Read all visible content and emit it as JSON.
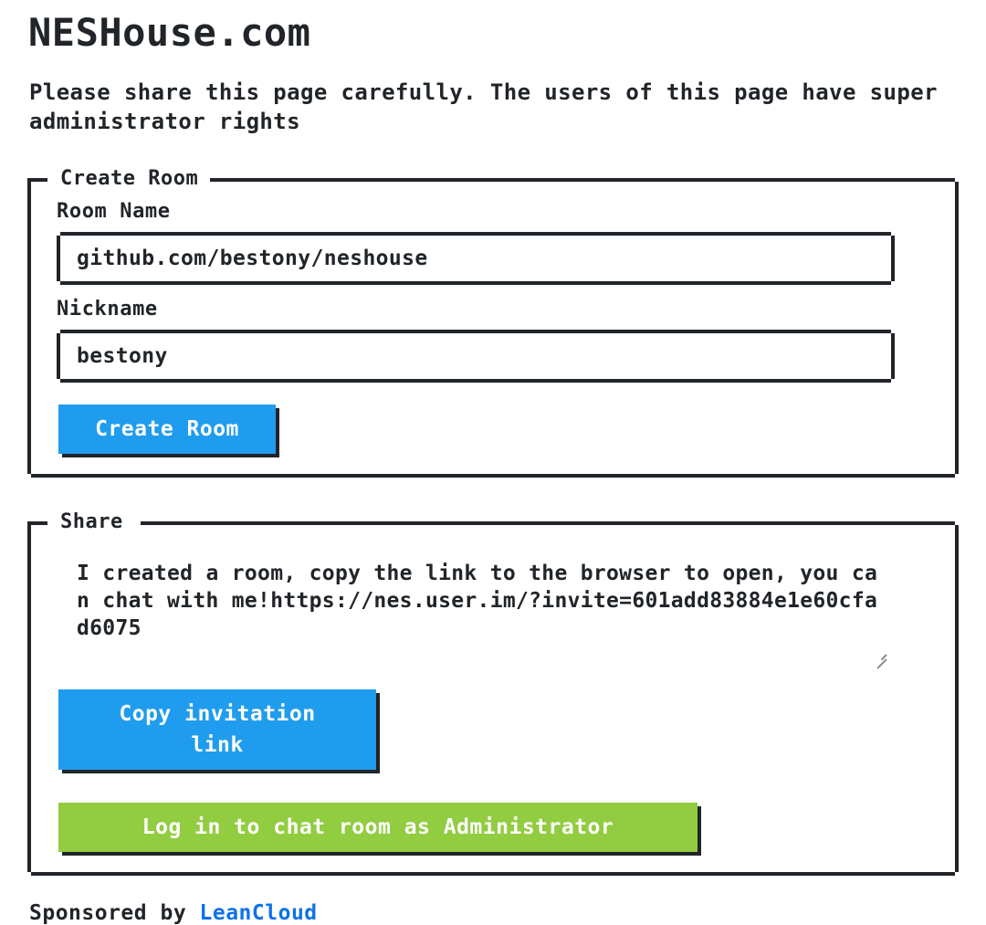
{
  "header": {
    "site_title": "NESHouse.com",
    "notice": "Please share this page carefully. The users of this page have super administrator rights"
  },
  "create_room": {
    "legend": "Create Room",
    "room_name_label": "Room Name",
    "room_name_value": "github.com/bestony/neshouse",
    "room_name_placeholder": "Room Name",
    "nickname_label": "Nickname",
    "nickname_value": "bestony",
    "nickname_placeholder": "Nickname",
    "create_button_label": "Create Room"
  },
  "share": {
    "legend": "Share",
    "invite_text": "I created a room, copy the link to the browser to open, you can chat with me!https://nes.user.im/?invite=601add83884e1e60cfad6075",
    "copy_button_line1": "Copy invitation",
    "copy_button_line2": "link",
    "login_button_label": "Log in to chat room as Administrator"
  },
  "footer": {
    "sponsored_prefix": "Sponsored by ",
    "sponsor_name": "LeanCloud"
  },
  "colors": {
    "ink": "#212529",
    "primary": "#209cee",
    "success": "#92cc41",
    "link": "#0f72e8",
    "background": "#ffffff"
  }
}
